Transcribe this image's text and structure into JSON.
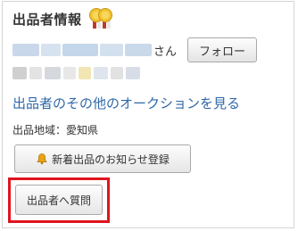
{
  "section": {
    "title": "出品者情報",
    "medal_icon": "gold-medal-icon"
  },
  "seller": {
    "name_suffix": "さん",
    "follow_label": "フォロー"
  },
  "links": {
    "other_auctions": "出品者のその他のオークションを見る"
  },
  "region": {
    "text": "出品地域：愛知県"
  },
  "buttons": {
    "notify_label": "新着出品のお知らせ登録",
    "notify_icon": "bell-icon",
    "ask_label": "出品者へ質問"
  },
  "colors": {
    "link": "#2f68a8",
    "highlight": "#e0141e",
    "bell": "#e8a317"
  }
}
